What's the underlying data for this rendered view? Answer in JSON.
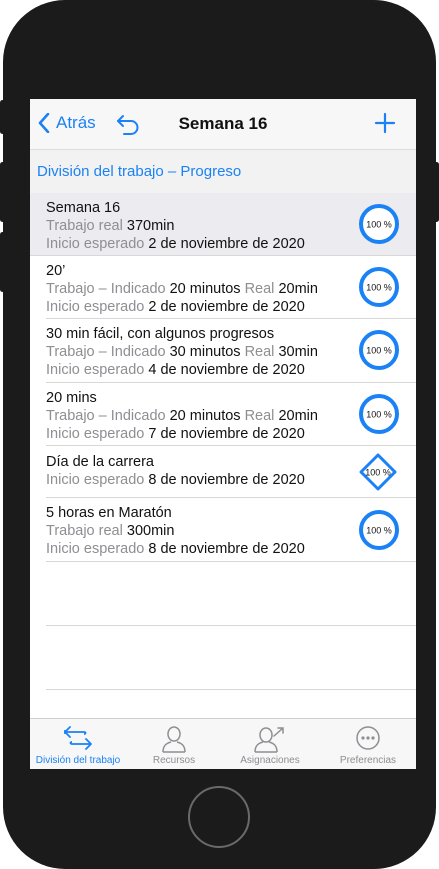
{
  "nav": {
    "back_label": "Atrás",
    "title": "Semana 16"
  },
  "breadcrumb": "División del trabajo – Progreso",
  "rows": [
    {
      "title": "Semana 16",
      "line2_label": "Trabajo real",
      "line2_value": "370min",
      "line2_extra_label": "",
      "line2_extra_value": "",
      "start_label": "Inicio esperado",
      "start_value": "2 de noviembre de 2020",
      "progress": "100 %",
      "shape": "circle",
      "selected": true
    },
    {
      "title": "20’",
      "line2_label": "Trabajo – Indicado",
      "line2_value": "20 minutos",
      "line2_extra_label": "Real",
      "line2_extra_value": "20min",
      "start_label": "Inicio esperado",
      "start_value": "2 de noviembre de 2020",
      "progress": "100 %",
      "shape": "circle"
    },
    {
      "title": "30 min fácil, con algunos progresos",
      "line2_label": "Trabajo – Indicado",
      "line2_value": "30 minutos",
      "line2_extra_label": "Real",
      "line2_extra_value": "30min",
      "start_label": "Inicio esperado",
      "start_value": "4 de noviembre de 2020",
      "progress": "100 %",
      "shape": "circle"
    },
    {
      "title": "20 mins",
      "line2_label": "Trabajo – Indicado",
      "line2_value": "20 minutos",
      "line2_extra_label": "Real",
      "line2_extra_value": "20min",
      "start_label": "Inicio esperado",
      "start_value": "7 de noviembre de 2020",
      "progress": "100 %",
      "shape": "circle"
    },
    {
      "title": "Día de la carrera",
      "start_label": "Inicio esperado",
      "start_value": "8 de noviembre de 2020",
      "progress": "100 %",
      "shape": "diamond"
    },
    {
      "title": "5 horas en Maratón",
      "line2_label": "Trabajo real",
      "line2_value": "300min",
      "line2_extra_label": "",
      "line2_extra_value": "",
      "start_label": "Inicio esperado",
      "start_value": "8 de noviembre de 2020",
      "progress": "100 %",
      "shape": "circle"
    }
  ],
  "tabs": [
    {
      "label": "División del trabajo",
      "icon": "swap-arrows-icon",
      "active": true
    },
    {
      "label": "Recursos",
      "icon": "person-icon",
      "active": false
    },
    {
      "label": "Asignaciones",
      "icon": "assign-person-icon",
      "active": false
    },
    {
      "label": "Preferencias",
      "icon": "more-circle-icon",
      "active": false
    }
  ],
  "colors": {
    "accent": "#1a82f5",
    "muted": "#8e8e93",
    "selected_row": "#ebebf0"
  }
}
